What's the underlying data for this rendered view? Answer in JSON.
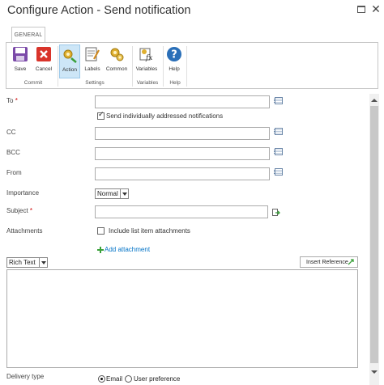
{
  "window": {
    "title": "Configure Action - Send notification"
  },
  "ribbon": {
    "tab": "GENERAL",
    "buttons": [
      {
        "label": "Save",
        "icon": "save-icon"
      },
      {
        "label": "Cancel",
        "icon": "cancel-icon"
      },
      {
        "label": "Action",
        "icon": "action-icon"
      },
      {
        "label": "Labels",
        "icon": "labels-icon"
      },
      {
        "label": "Common",
        "icon": "common-icon"
      },
      {
        "label": "Variables",
        "icon": "variables-icon"
      },
      {
        "label": "Help",
        "icon": "help-icon"
      }
    ],
    "groups": [
      "Commit",
      "Settings",
      "Variables",
      "Help"
    ]
  },
  "form": {
    "to_label": "To",
    "send_individually_label": "Send individually addressed notifications",
    "cc_label": "CC",
    "bcc_label": "BCC",
    "from_label": "From",
    "importance_label": "Importance",
    "importance_value": "Normal",
    "subject_label": "Subject",
    "attachments_label": "Attachments",
    "include_attachments_label": "Include list item attachments",
    "add_attachment": "Add attachment",
    "format_value": "Rich Text",
    "insert_reference": "Insert Reference",
    "delivery_type_label": "Delivery type",
    "delivery_email": "Email",
    "delivery_user_pref": "User preference",
    "required_marker": "*"
  },
  "colors": {
    "link": "#0072c6",
    "required": "#cc0000",
    "active_button_bg": "#cde6f7"
  }
}
